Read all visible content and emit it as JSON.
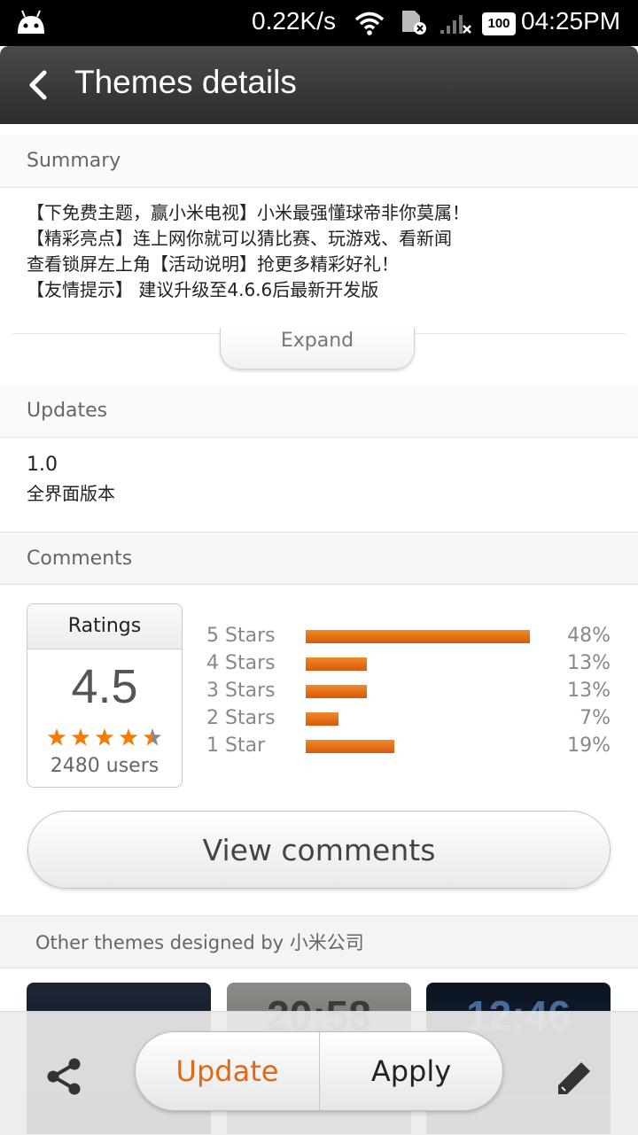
{
  "status_bar": {
    "net_speed": "0.22K/s",
    "battery": "100",
    "time": "04:25PM",
    "icons": [
      "android-icon",
      "wifi-icon",
      "sim-icon",
      "signal-icon"
    ]
  },
  "header": {
    "title": "Themes details",
    "back_icon": "chevron-left-icon"
  },
  "summary": {
    "label": "Summary",
    "lines": [
      "【下免费主题，赢小米电视】小米最强懂球帝非你莫属！",
      "【精彩亮点】连上网你就可以猜比赛、玩游戏、看新闻",
      "查看锁屏左上角【活动说明】抢更多精彩好礼！",
      "【友情提示】 建议升级至4.6.6后最新开发版"
    ],
    "expand_label": "Expand"
  },
  "updates": {
    "label": "Updates",
    "version": "1.0",
    "note": "全界面版本"
  },
  "comments": {
    "label": "Comments",
    "ratings_title": "Ratings",
    "score": "4.5",
    "star_rating": 4.5,
    "users": "2480 users",
    "distribution": [
      {
        "label": "5 Stars",
        "pct": "48%",
        "fraction": 0.48
      },
      {
        "label": "4 Stars",
        "pct": "13%",
        "fraction": 0.13
      },
      {
        "label": "3 Stars",
        "pct": "13%",
        "fraction": 0.13
      },
      {
        "label": "2 Stars",
        "pct": "7%",
        "fraction": 0.07
      },
      {
        "label": "1 Star",
        "pct": "19%",
        "fraction": 0.19
      }
    ],
    "view_comments_label": "View comments"
  },
  "others": {
    "label": "Other themes designed by 小米公司",
    "thumbs": [
      {
        "clock": ""
      },
      {
        "clock": "20:58"
      },
      {
        "clock": "12:46"
      }
    ]
  },
  "actions": {
    "update_label": "Update",
    "apply_label": "Apply"
  },
  "colors": {
    "accent": "#e06a14",
    "star": "#f57c00",
    "title_bar": "#3a3a3a"
  }
}
